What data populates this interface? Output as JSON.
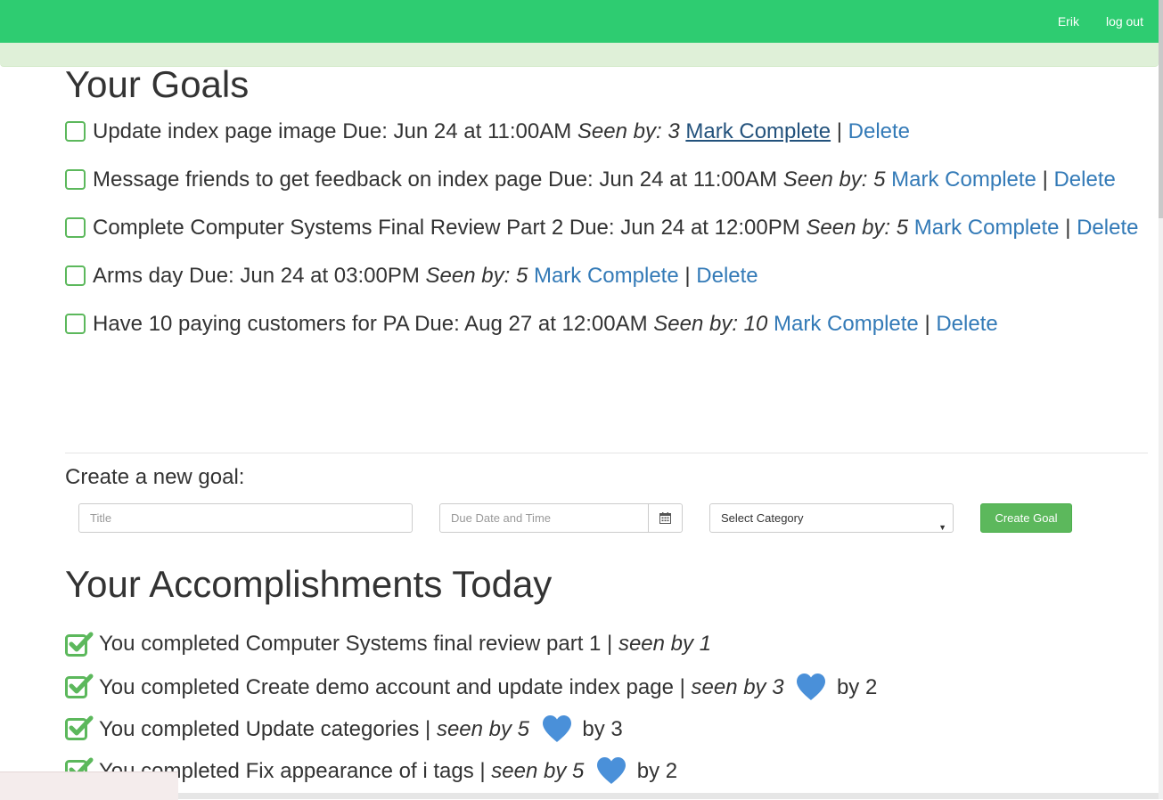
{
  "nav": {
    "user": "Erik",
    "logout": "log out"
  },
  "goals": {
    "title": "Your Goals",
    "seen_label": "Seen by:",
    "mark_label": "Mark Complete",
    "delete_label": "Delete",
    "separator": "|",
    "items": [
      {
        "text": "Update index page image Due: Jun 24 at 11:00AM",
        "seen": "3"
      },
      {
        "text": "Message friends to get feedback on index page Due: Jun 24 at 11:00AM",
        "seen": "5"
      },
      {
        "text": "Complete Computer Systems Final Review Part 2 Due: Jun 24 at 12:00PM",
        "seen": "5"
      },
      {
        "text": "Arms day Due: Jun 24 at 03:00PM",
        "seen": "5"
      },
      {
        "text": "Have 10 paying customers for PA Due: Aug 27 at 12:00AM",
        "seen": "10"
      }
    ]
  },
  "create": {
    "label": "Create a new goal:",
    "title_placeholder": "Title",
    "date_placeholder": "Due Date and Time",
    "category_selected": "Select Category",
    "button": "Create Goal"
  },
  "accomplishments": {
    "title": "Your Accomplishments Today",
    "seen_label": "seen by",
    "likes_label": "by",
    "items": [
      {
        "text": "You completed Computer Systems final review part 1 |",
        "seen": "1",
        "likes": null
      },
      {
        "text": "You completed Create demo account and update index page |",
        "seen": "3",
        "likes": "2"
      },
      {
        "text": "You completed Update categories |",
        "seen": "5",
        "likes": "3"
      },
      {
        "text": "You completed Fix appearance of i tags |",
        "seen": "5",
        "likes": "2"
      }
    ]
  },
  "colors": {
    "navbar": "#2ecc71",
    "link": "#337ab7",
    "success": "#5cb85c",
    "heart": "#4a90d9"
  }
}
